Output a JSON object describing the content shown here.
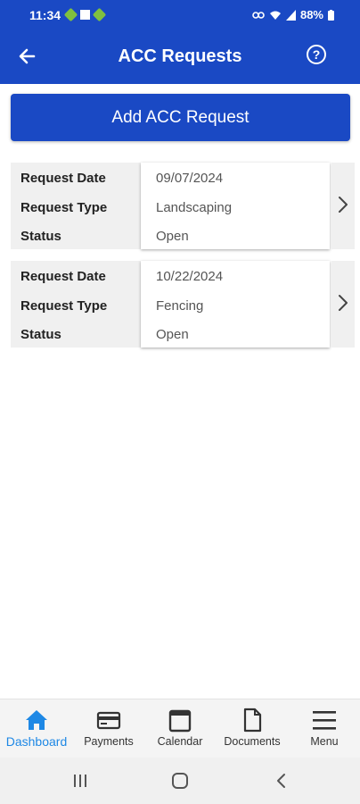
{
  "status_bar": {
    "time": "11:34",
    "battery": "88%"
  },
  "app_bar": {
    "title": "ACC Requests",
    "back_icon": "arrow-left-icon",
    "help_icon": "help-circle-icon",
    "help_glyph": "?"
  },
  "add_button": {
    "label": "Add ACC Request"
  },
  "field_labels": {
    "date": "Request Date",
    "type": "Request Type",
    "status": "Status"
  },
  "requests": [
    {
      "date": "09/07/2024",
      "type": "Landscaping",
      "status": "Open"
    },
    {
      "date": "10/22/2024",
      "type": "Fencing",
      "status": "Open"
    }
  ],
  "bottom_nav": {
    "items": [
      {
        "label": "Dashboard",
        "icon": "home-icon",
        "active": true
      },
      {
        "label": "Payments",
        "icon": "credit-card-icon",
        "active": false
      },
      {
        "label": "Calendar",
        "icon": "calendar-icon",
        "active": false
      },
      {
        "label": "Documents",
        "icon": "document-icon",
        "active": false
      },
      {
        "label": "Menu",
        "icon": "hamburger-menu-icon",
        "active": false
      }
    ]
  },
  "colors": {
    "primary": "#1a49c4",
    "active_nav": "#1e88e5"
  }
}
